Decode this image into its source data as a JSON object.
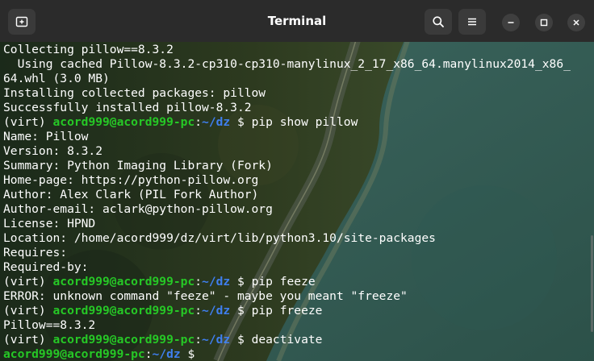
{
  "window": {
    "title": "Terminal"
  },
  "icons": {
    "new_tab": "new-tab-icon",
    "search": "search-icon",
    "menu": "hamburger-menu-icon",
    "minimize": "minimize-icon",
    "maximize": "maximize-icon",
    "close": "close-icon"
  },
  "colors": {
    "titlebar": "#2b2b2b",
    "prompt_user": "#26c826",
    "prompt_path": "#3f7ff0",
    "text": "#ffffff"
  },
  "prompt": {
    "venv": "(virt) ",
    "user_host": "acord999@acord999-pc",
    "sep": ":",
    "path": "~/dz",
    "symbol": " $ "
  },
  "output": {
    "l1": "Collecting pillow==8.3.2",
    "l2": "  Using cached Pillow-8.3.2-cp310-cp310-manylinux_2_17_x86_64.manylinux2014_x86_",
    "l3": "64.whl (3.0 MB)",
    "l4": "Installing collected packages: pillow",
    "l5": "Successfully installed pillow-8.3.2",
    "l7": "Name: Pillow",
    "l8": "Version: 8.3.2",
    "l9": "Summary: Python Imaging Library (Fork)",
    "l10": "Home-page: https://python-pillow.org",
    "l11": "Author: Alex Clark (PIL Fork Author)",
    "l12": "Author-email: aclark@python-pillow.org",
    "l13": "License: HPND",
    "l14": "Location: /home/acord999/dz/virt/lib/python3.10/site-packages",
    "l15": "Requires:",
    "l16": "Required-by:",
    "l18": "ERROR: unknown command \"feeze\" - maybe you meant \"freeze\"",
    "l20": "Pillow==8.3.2"
  },
  "commands": {
    "c1": "pip show pillow",
    "c2": "pip feeze",
    "c3": "pip freeze",
    "c4": "deactivate"
  }
}
